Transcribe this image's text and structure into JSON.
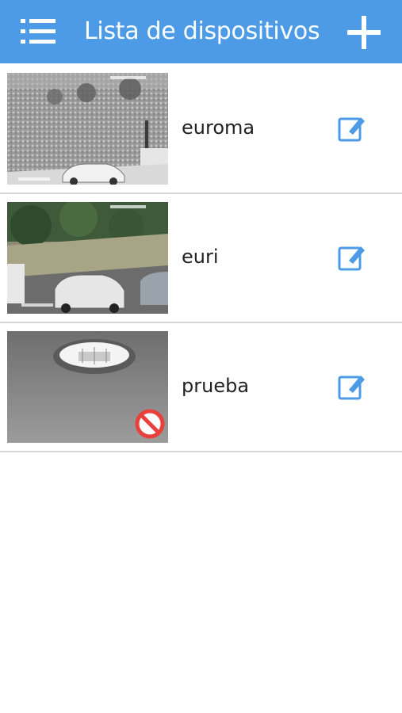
{
  "header": {
    "title": "Lista de dispositivos",
    "menu_icon": "menu-list-icon",
    "add_icon": "plus-icon",
    "background_color": "#4d9be6"
  },
  "devices": [
    {
      "name": "euroma",
      "status": "online",
      "edit_icon": "edit-icon"
    },
    {
      "name": "euri",
      "status": "online",
      "edit_icon": "edit-icon"
    },
    {
      "name": "prueba",
      "status": "offline",
      "status_icon": "no-entry-icon",
      "edit_icon": "edit-icon"
    }
  ],
  "colors": {
    "accent": "#4d9be6",
    "divider": "#d6d6d6",
    "offline": "#e8413c"
  }
}
